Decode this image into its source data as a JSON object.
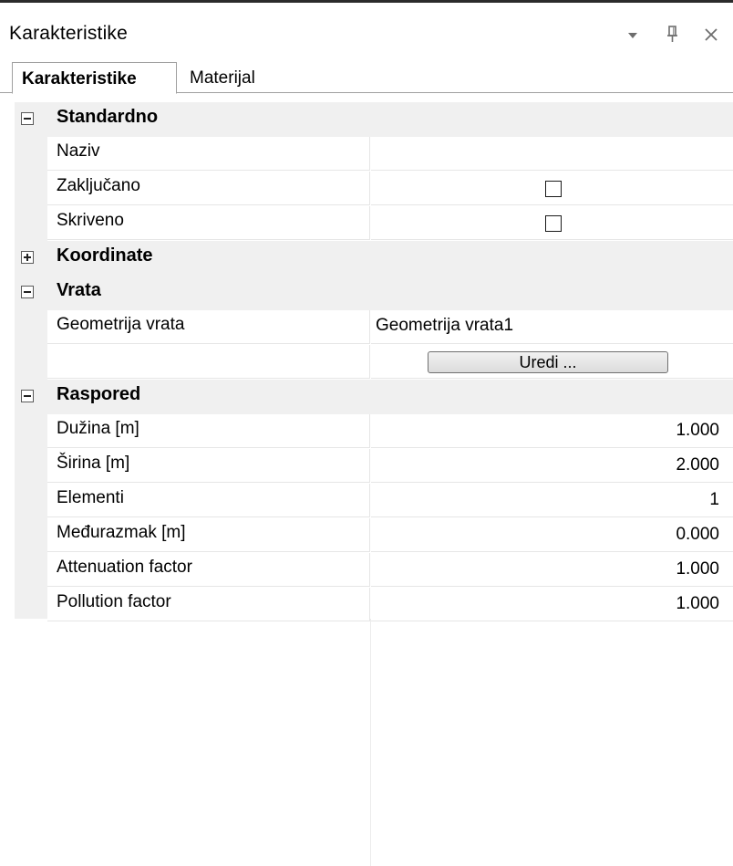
{
  "window": {
    "title": "Karakteristike",
    "controls": {
      "dropdown": "▾",
      "pin": "⊥",
      "close": "✕"
    }
  },
  "tabs": [
    {
      "label": "Karakteristike",
      "active": true
    },
    {
      "label": "Materijal",
      "active": false
    }
  ],
  "categories": {
    "standardno": {
      "label": "Standardno",
      "expanded": true,
      "naziv": {
        "name": "Naziv",
        "value": ""
      },
      "zakljucano": {
        "name": "Zaključano",
        "checked": false
      },
      "skriveno": {
        "name": "Skriveno",
        "checked": false
      }
    },
    "koordinate": {
      "label": "Koordinate",
      "expanded": false
    },
    "vrata": {
      "label": "Vrata",
      "expanded": true,
      "geometrija": {
        "name": "Geometrija vrata",
        "value": "Geometrija vrata1"
      },
      "edit_button": "Uredi ..."
    },
    "raspored": {
      "label": "Raspored",
      "expanded": true,
      "duzina": {
        "name": "Dužina [m]",
        "value": "1.000"
      },
      "sirina": {
        "name": "Širina [m]",
        "value": "2.000"
      },
      "elementi": {
        "name": "Elementi",
        "value": "1"
      },
      "meduraz": {
        "name": "Međurazmak [m]",
        "value": "0.000"
      },
      "attenuation": {
        "name": "Attenuation factor",
        "value": "1.000"
      },
      "pollution": {
        "name": "Pollution factor",
        "value": "1.000"
      }
    }
  }
}
